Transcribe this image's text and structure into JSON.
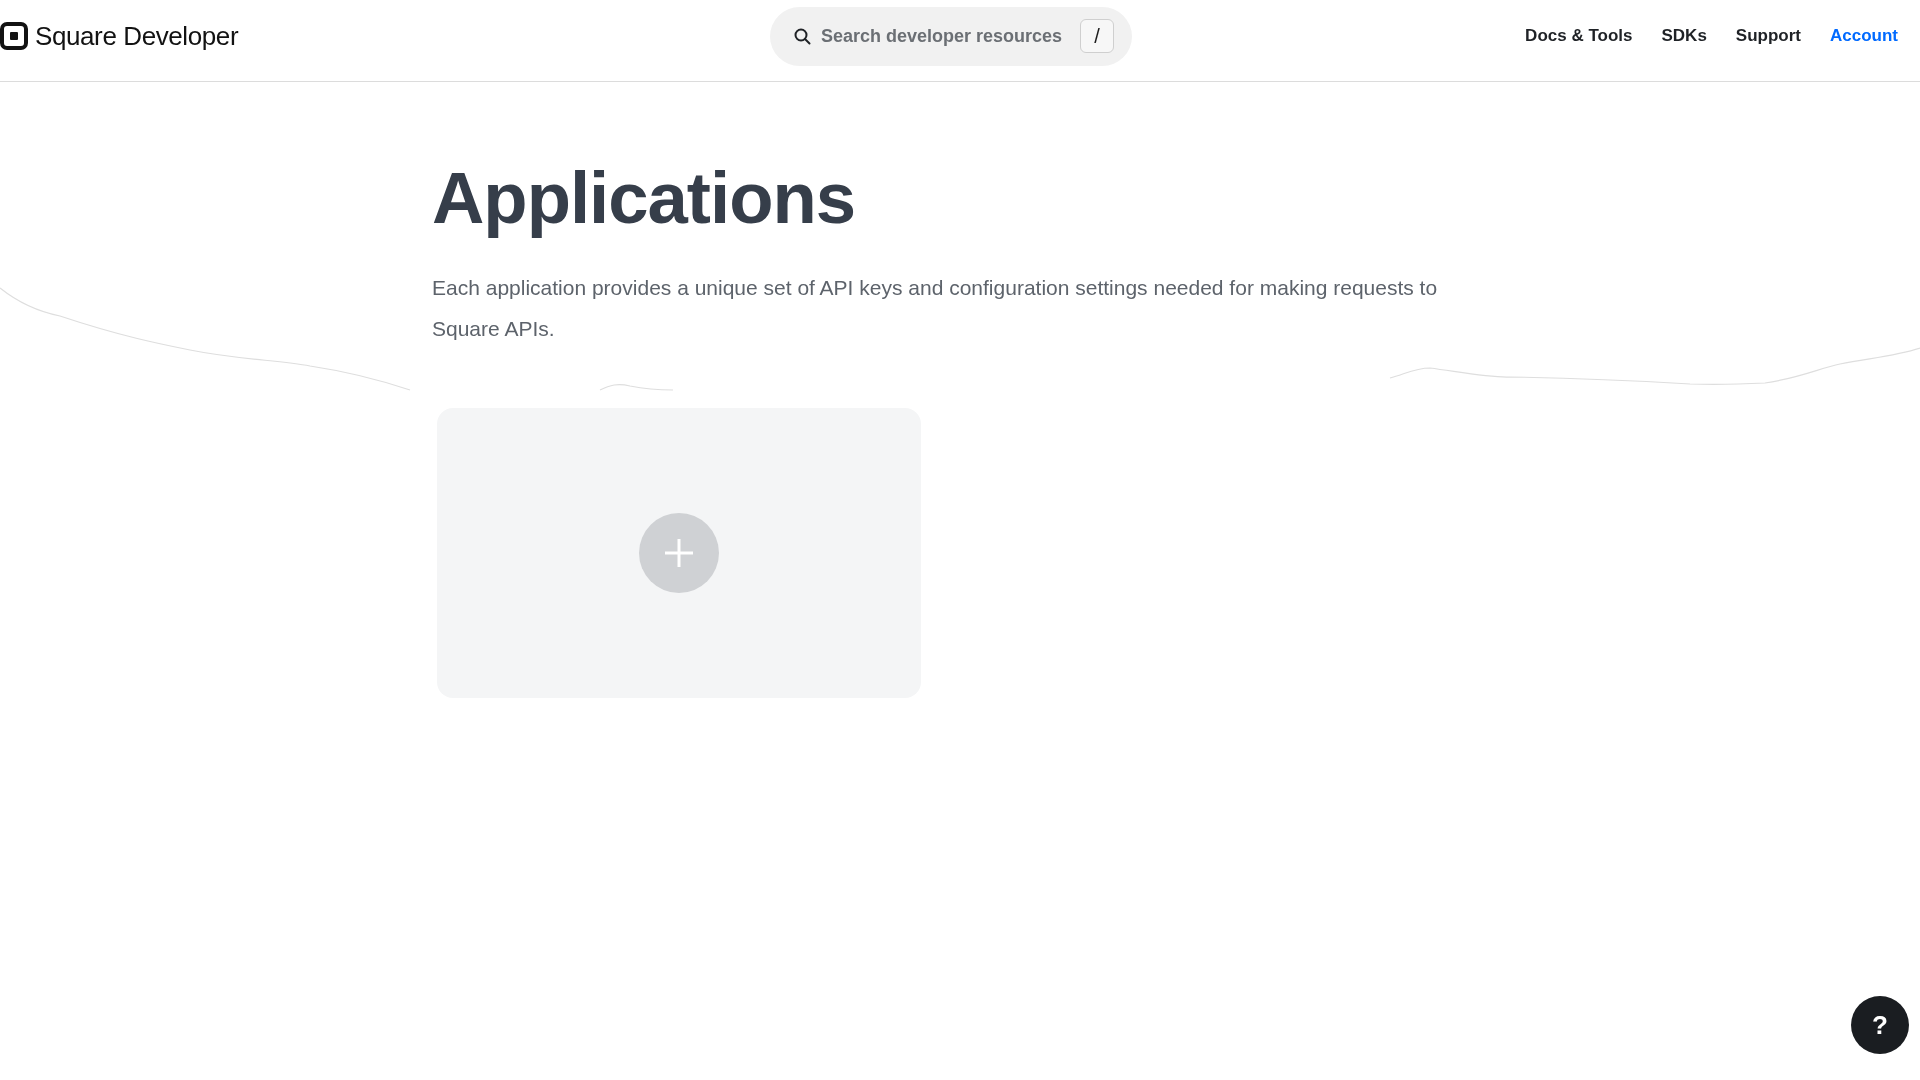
{
  "header": {
    "logo": {
      "text": "Square Developer"
    },
    "search": {
      "placeholder": "Search developer resources",
      "shortcut_key": "/"
    },
    "nav": [
      {
        "label": "Docs & Tools",
        "selected": false
      },
      {
        "label": "SDKs",
        "selected": false
      },
      {
        "label": "Support",
        "selected": false
      },
      {
        "label": "Account",
        "selected": true
      }
    ]
  },
  "page": {
    "title": "Applications",
    "description": "Each application provides a unique set of API keys and configuration settings needed for making requests to Square APIs."
  },
  "help_button": {
    "label": "?"
  }
}
